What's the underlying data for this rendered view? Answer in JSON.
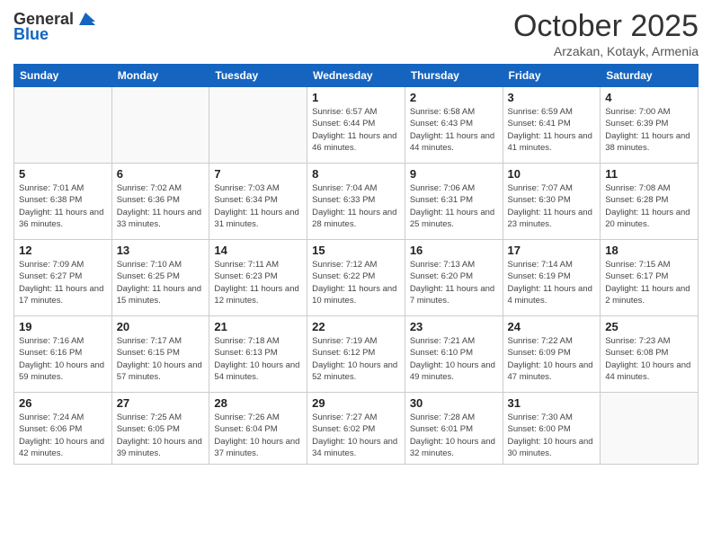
{
  "header": {
    "logo_general": "General",
    "logo_blue": "Blue",
    "title": "October 2025",
    "location": "Arzakan, Kotayk, Armenia"
  },
  "days_of_week": [
    "Sunday",
    "Monday",
    "Tuesday",
    "Wednesday",
    "Thursday",
    "Friday",
    "Saturday"
  ],
  "weeks": [
    [
      {
        "day": "",
        "info": ""
      },
      {
        "day": "",
        "info": ""
      },
      {
        "day": "",
        "info": ""
      },
      {
        "day": "1",
        "sunrise": "6:57 AM",
        "sunset": "6:44 PM",
        "daylight": "11 hours and 46 minutes."
      },
      {
        "day": "2",
        "sunrise": "6:58 AM",
        "sunset": "6:43 PM",
        "daylight": "11 hours and 44 minutes."
      },
      {
        "day": "3",
        "sunrise": "6:59 AM",
        "sunset": "6:41 PM",
        "daylight": "11 hours and 41 minutes."
      },
      {
        "day": "4",
        "sunrise": "7:00 AM",
        "sunset": "6:39 PM",
        "daylight": "11 hours and 38 minutes."
      }
    ],
    [
      {
        "day": "5",
        "sunrise": "7:01 AM",
        "sunset": "6:38 PM",
        "daylight": "11 hours and 36 minutes."
      },
      {
        "day": "6",
        "sunrise": "7:02 AM",
        "sunset": "6:36 PM",
        "daylight": "11 hours and 33 minutes."
      },
      {
        "day": "7",
        "sunrise": "7:03 AM",
        "sunset": "6:34 PM",
        "daylight": "11 hours and 31 minutes."
      },
      {
        "day": "8",
        "sunrise": "7:04 AM",
        "sunset": "6:33 PM",
        "daylight": "11 hours and 28 minutes."
      },
      {
        "day": "9",
        "sunrise": "7:06 AM",
        "sunset": "6:31 PM",
        "daylight": "11 hours and 25 minutes."
      },
      {
        "day": "10",
        "sunrise": "7:07 AM",
        "sunset": "6:30 PM",
        "daylight": "11 hours and 23 minutes."
      },
      {
        "day": "11",
        "sunrise": "7:08 AM",
        "sunset": "6:28 PM",
        "daylight": "11 hours and 20 minutes."
      }
    ],
    [
      {
        "day": "12",
        "sunrise": "7:09 AM",
        "sunset": "6:27 PM",
        "daylight": "11 hours and 17 minutes."
      },
      {
        "day": "13",
        "sunrise": "7:10 AM",
        "sunset": "6:25 PM",
        "daylight": "11 hours and 15 minutes."
      },
      {
        "day": "14",
        "sunrise": "7:11 AM",
        "sunset": "6:23 PM",
        "daylight": "11 hours and 12 minutes."
      },
      {
        "day": "15",
        "sunrise": "7:12 AM",
        "sunset": "6:22 PM",
        "daylight": "11 hours and 10 minutes."
      },
      {
        "day": "16",
        "sunrise": "7:13 AM",
        "sunset": "6:20 PM",
        "daylight": "11 hours and 7 minutes."
      },
      {
        "day": "17",
        "sunrise": "7:14 AM",
        "sunset": "6:19 PM",
        "daylight": "11 hours and 4 minutes."
      },
      {
        "day": "18",
        "sunrise": "7:15 AM",
        "sunset": "6:17 PM",
        "daylight": "11 hours and 2 minutes."
      }
    ],
    [
      {
        "day": "19",
        "sunrise": "7:16 AM",
        "sunset": "6:16 PM",
        "daylight": "10 hours and 59 minutes."
      },
      {
        "day": "20",
        "sunrise": "7:17 AM",
        "sunset": "6:15 PM",
        "daylight": "10 hours and 57 minutes."
      },
      {
        "day": "21",
        "sunrise": "7:18 AM",
        "sunset": "6:13 PM",
        "daylight": "10 hours and 54 minutes."
      },
      {
        "day": "22",
        "sunrise": "7:19 AM",
        "sunset": "6:12 PM",
        "daylight": "10 hours and 52 minutes."
      },
      {
        "day": "23",
        "sunrise": "7:21 AM",
        "sunset": "6:10 PM",
        "daylight": "10 hours and 49 minutes."
      },
      {
        "day": "24",
        "sunrise": "7:22 AM",
        "sunset": "6:09 PM",
        "daylight": "10 hours and 47 minutes."
      },
      {
        "day": "25",
        "sunrise": "7:23 AM",
        "sunset": "6:08 PM",
        "daylight": "10 hours and 44 minutes."
      }
    ],
    [
      {
        "day": "26",
        "sunrise": "7:24 AM",
        "sunset": "6:06 PM",
        "daylight": "10 hours and 42 minutes."
      },
      {
        "day": "27",
        "sunrise": "7:25 AM",
        "sunset": "6:05 PM",
        "daylight": "10 hours and 39 minutes."
      },
      {
        "day": "28",
        "sunrise": "7:26 AM",
        "sunset": "6:04 PM",
        "daylight": "10 hours and 37 minutes."
      },
      {
        "day": "29",
        "sunrise": "7:27 AM",
        "sunset": "6:02 PM",
        "daylight": "10 hours and 34 minutes."
      },
      {
        "day": "30",
        "sunrise": "7:28 AM",
        "sunset": "6:01 PM",
        "daylight": "10 hours and 32 minutes."
      },
      {
        "day": "31",
        "sunrise": "7:30 AM",
        "sunset": "6:00 PM",
        "daylight": "10 hours and 30 minutes."
      },
      {
        "day": "",
        "info": ""
      }
    ]
  ],
  "labels": {
    "sunrise": "Sunrise:",
    "sunset": "Sunset:",
    "daylight": "Daylight:"
  }
}
